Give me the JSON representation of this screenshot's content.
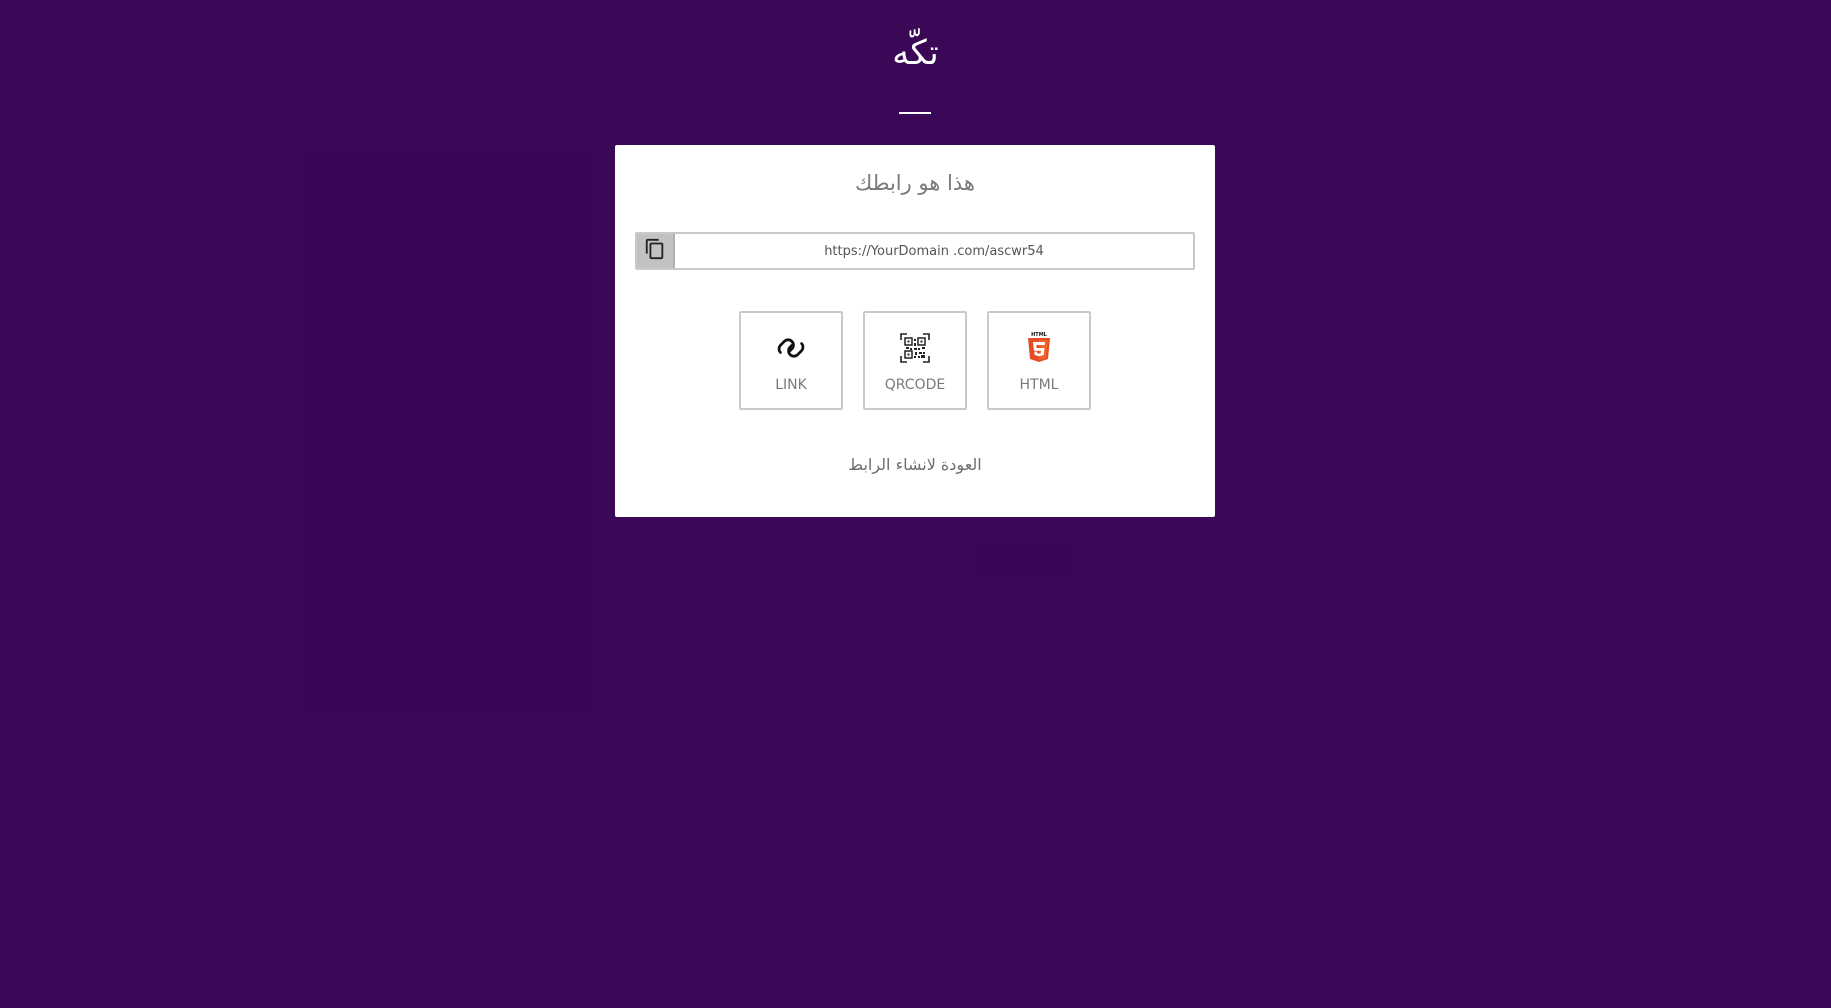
{
  "brand": {
    "title": "تكّه"
  },
  "card": {
    "title": "هذا هو رابطك",
    "url_value": "https://YourDomain .com/ascwr54",
    "options": [
      {
        "label": "LINK",
        "icon": "link-icon"
      },
      {
        "label": "QRCODE",
        "icon": "qrcode-icon"
      },
      {
        "label": "HTML",
        "icon": "html5-icon"
      }
    ],
    "back_label": "العودة لانشاء الرابط"
  },
  "colors": {
    "background": "#3b0858",
    "card": "#ffffff",
    "border": "#c9c9c9",
    "copy_button": "#c2c2c2",
    "html5_orange": "#e44d26"
  }
}
